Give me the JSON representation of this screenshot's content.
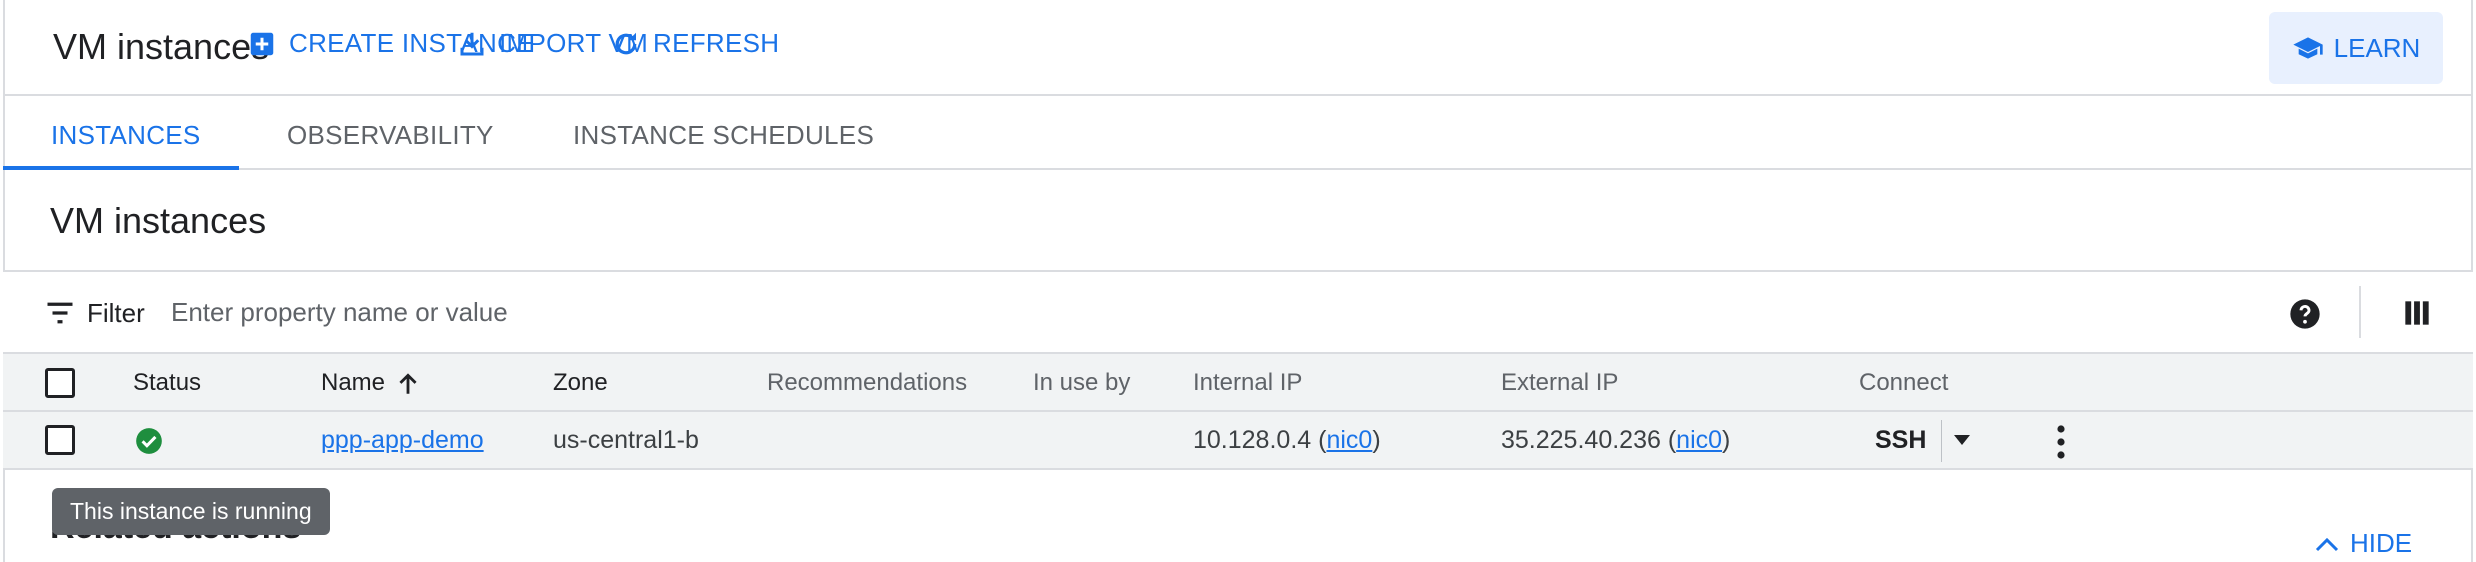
{
  "header": {
    "title": "VM instances",
    "create_label": "CREATE INSTANCE",
    "import_label": "IMPORT VM",
    "refresh_label": "REFRESH",
    "learn_label": "LEARN"
  },
  "tabs": [
    {
      "label": "INSTANCES",
      "active": true
    },
    {
      "label": "OBSERVABILITY",
      "active": false
    },
    {
      "label": "INSTANCE SCHEDULES",
      "active": false
    }
  ],
  "section_title": "VM instances",
  "filter": {
    "label": "Filter",
    "placeholder": "Enter property name or value",
    "value": ""
  },
  "table": {
    "columns": [
      "Status",
      "Name",
      "Zone",
      "Recommendations",
      "In use by",
      "Internal IP",
      "External IP",
      "Connect"
    ],
    "sort_column": "Name",
    "rows": [
      {
        "status": "running",
        "name": "ppp-app-demo",
        "zone": "us-central1-b",
        "recommendations": "",
        "in_use_by": "",
        "internal_ip": "10.128.0.4",
        "internal_nic": "nic0",
        "external_ip": "35.225.40.236",
        "external_nic": "nic0",
        "connect": "SSH"
      }
    ]
  },
  "tooltip": "This instance is running",
  "related_actions": "Related actions",
  "hide_label": "HIDE",
  "colors": {
    "accent": "#1a73e8",
    "running": "#1e8e3e",
    "header_bg": "#f1f3f4",
    "tooltip_bg": "#5f6368"
  }
}
